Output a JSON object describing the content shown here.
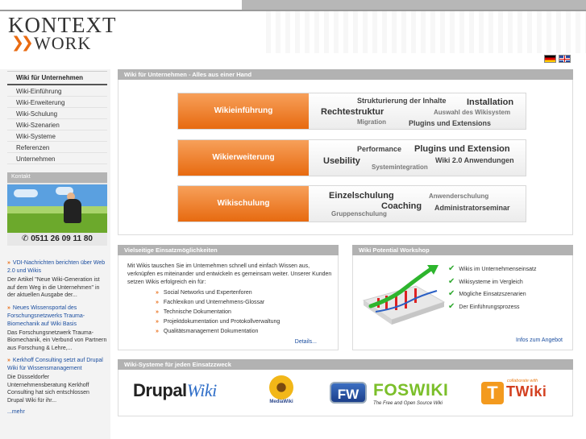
{
  "brand": {
    "logo_line1": "KONTEXT",
    "logo_line2": "WORK",
    "logo_chevrons": "❯❯",
    "accent_color": "#e96b12"
  },
  "languages": [
    "de",
    "en"
  ],
  "nav": {
    "header": "Wiki für Unternehmen",
    "items": [
      "Wiki-Einführung",
      "Wiki-Erweiterung",
      "Wiki-Schulung",
      "Wiki-Szenarien",
      "Wiki-Systeme",
      "Referenzen",
      "Unternehmen"
    ]
  },
  "kontakt": {
    "title": "Kontakt",
    "phone": "0511 26 09 11 80",
    "phone_icon": "phone-icon"
  },
  "news": [
    {
      "title": "VDI-Nachrichten berichten über Web 2.0 und Wikis",
      "text": "Der Artikel \"Neue Wiki-Generation ist auf dem Weg in die Unternehmen\" in der aktuellen Ausgabe der..."
    },
    {
      "title": "Neues Wissensportal des Forschungsnetzwerks Trauma-Biomechanik auf Wiki Basis",
      "text": "Das Forschungsnetzwerk Trauma-Biomechanik, ein Verbund von Partnern aus Forschung & Lehre,..."
    },
    {
      "title": "Kerkhoff Consulting setzt auf Drupal Wiki für Wissensmanagement",
      "text": "Die Düsseldorfer Unternehmensberatung Kerkhoff Consulting hat sich entschlossen Drupal Wiki für ihr..."
    }
  ],
  "news_more": "...mehr",
  "hero": {
    "title": "Wiki für Unternehmen - Alles aus einer Hand",
    "rows": [
      {
        "button": "Wikieinführung",
        "keywords": [
          "Strukturierung der Inhalte",
          "Installation",
          "Rechtestruktur",
          "Auswahl des Wikisystem",
          "Migration",
          "Plugins und Extensions"
        ]
      },
      {
        "button": "Wikierweiterung",
        "keywords": [
          "Performance",
          "Plugins und Extension",
          "Usebility",
          "Wiki 2.0 Anwendungen",
          "Systemintegration"
        ]
      },
      {
        "button": "Wikischulung",
        "keywords": [
          "Einzelschulung",
          "Anwenderschulung",
          "Coaching",
          "Administratorseminar",
          "Gruppenschulung"
        ]
      }
    ]
  },
  "vielseitig": {
    "title": "Vielseitige Einsatzmöglichkeiten",
    "intro": "Mit Wikis tauschen Sie im Unternehmen schnell und einfach Wissen aus, verknüpfen es miteinander und entwickeln es gemeinsam weiter. Unserer Kunden setzen Wikis erfolgreich ein für:",
    "items": [
      "Social Networks und Expertenforen",
      "Fachlexikon und Unternehmens-Glossar",
      "Technische Dokumentation",
      "Projektdokumentation und Protokollverwaltung",
      "Qualitätsmanagement Dokumentation"
    ],
    "details": "Details..."
  },
  "workshop": {
    "title": "Wiki Potential Workshop",
    "items": [
      "Wikis im Unternehmenseinsatz",
      "Wikisysteme im Vergleich",
      "Mögliche Einsatzszenarien",
      "Der Einführungsprozess"
    ],
    "info": "Infos zum Angebot"
  },
  "systems": {
    "title": "Wiki-Systeme für jeden Einsatzzweck",
    "drupal_a": "Drupal",
    "drupal_b": "Wiki",
    "mediawiki": "MediaWiki",
    "foswiki_fw": "FW",
    "foswiki_name": "FOSWIKI",
    "foswiki_tag": "The Free and Open Source Wiki",
    "twiki_collab": "collaborate with",
    "twiki_name": "TWiki"
  }
}
